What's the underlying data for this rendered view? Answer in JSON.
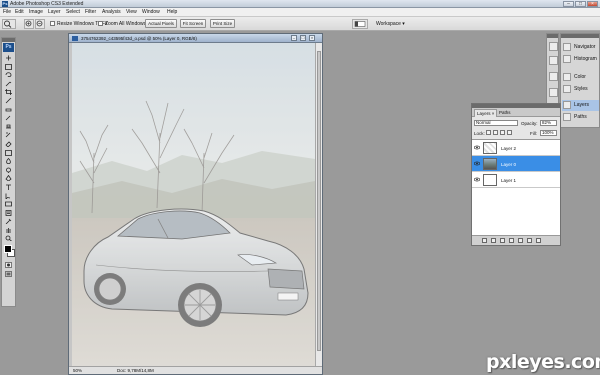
{
  "app": {
    "title": "Adobe Photoshop CS3 Extended",
    "logo_text": "Ps"
  },
  "window_controls": {
    "minimize": "–",
    "maximize": "□",
    "close": "×"
  },
  "menu": [
    "File",
    "Edit",
    "Image",
    "Layer",
    "Select",
    "Filter",
    "Analysis",
    "View",
    "Window",
    "Help"
  ],
  "options_bar": {
    "resize_windows_label": "Resize Windows To Fit",
    "zoom_all_windows_label": "Zoom All Windows",
    "actual_pixels": "Actual Pixels",
    "fit_screen": "Fit Screen",
    "print_size": "Print Size",
    "workspace": "Workspace ▾"
  },
  "document": {
    "title": "3754762392_c43595f43d_o.psd @ 50% (Layer 0, RGB/8)",
    "zoom": "50%",
    "doc_size": "Doc: 9,78M/14,8M"
  },
  "dock": {
    "items": [
      {
        "label": "Navigator",
        "icon": "navigator-icon"
      },
      {
        "label": "Histogram",
        "icon": "histogram-icon"
      },
      {
        "label": "Color",
        "icon": "color-icon"
      },
      {
        "label": "Styles",
        "icon": "styles-icon"
      },
      {
        "label": "Layers",
        "icon": "layers-icon",
        "active": true
      },
      {
        "label": "Paths",
        "icon": "paths-icon"
      }
    ]
  },
  "layers_panel": {
    "tabs": [
      "Layers ×",
      "Paths"
    ],
    "blend_mode": "Normal",
    "opacity_label": "Opacity:",
    "opacity_value": "82%",
    "lock_label": "Lock:",
    "fill_label": "Fill:",
    "fill_value": "100%",
    "layers": [
      {
        "name": "Layer 2",
        "selected": false
      },
      {
        "name": "Layer 0",
        "selected": true
      },
      {
        "name": "Layer 1",
        "selected": false
      }
    ]
  },
  "watermark": "pxleyes.com",
  "colors": {
    "accent_selection": "#3a8ee6",
    "workspace_bg": "#9a9a9a",
    "foreground": "#000000",
    "background": "#ffffff"
  }
}
